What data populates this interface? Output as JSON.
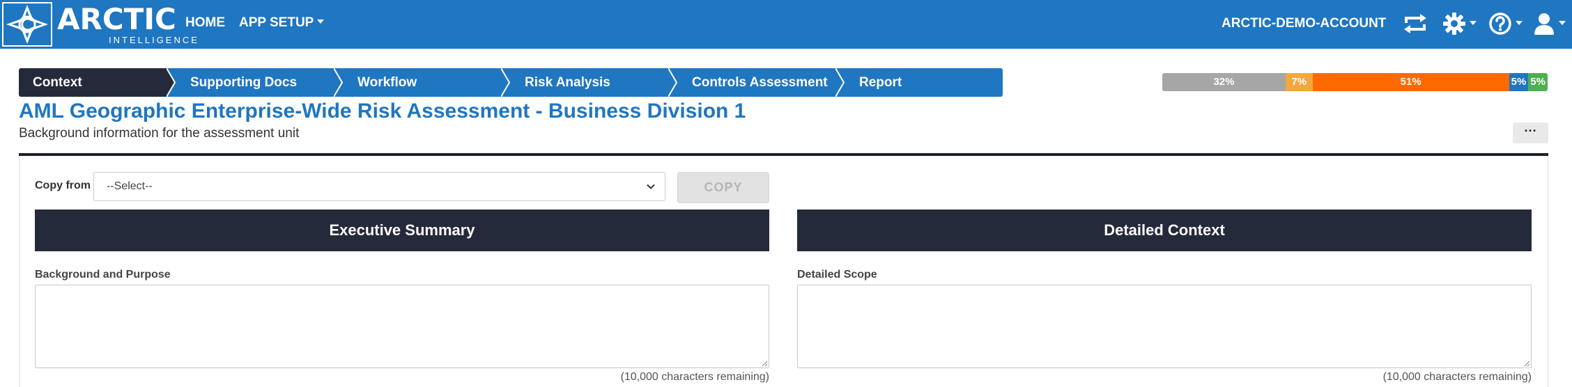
{
  "navbar": {
    "brand_name": "ARCTIC",
    "brand_sub": "INTELLIGENCE",
    "home_label": "HOME",
    "app_setup_label": "APP SETUP",
    "account_label": "ARCTIC-DEMO-ACCOUNT",
    "icons": [
      "sync-icon",
      "gear-icon",
      "help-icon",
      "user-icon"
    ],
    "color": "#1f76c1"
  },
  "steps": [
    {
      "label": "Context",
      "active": true
    },
    {
      "label": "Supporting Docs",
      "active": false
    },
    {
      "label": "Workflow",
      "active": false
    },
    {
      "label": "Risk Analysis",
      "active": false
    },
    {
      "label": "Controls Assessment",
      "active": false
    },
    {
      "label": "Report",
      "active": false
    }
  ],
  "progress": [
    {
      "label": "32%",
      "value": 32,
      "color": "#a6a6a6"
    },
    {
      "label": "7%",
      "value": 7,
      "color": "#f5a63d"
    },
    {
      "label": "51%",
      "value": 51,
      "color": "#ff6a00"
    },
    {
      "label": "5%",
      "value": 5,
      "color": "#1f76c1"
    },
    {
      "label": "5%",
      "value": 5,
      "color": "#4caf50"
    }
  ],
  "page": {
    "title": "AML Geographic Enterprise-Wide Risk Assessment - Business Division 1",
    "subtitle": "Background information for the assessment unit",
    "more_label": "···"
  },
  "copy": {
    "label": "Copy from",
    "select_value": "--Select--",
    "button_label": "COPY"
  },
  "sections": {
    "left": {
      "title": "Executive Summary",
      "field_label": "Background and Purpose",
      "value": "",
      "remaining": "(10,000 characters remaining)"
    },
    "right": {
      "title": "Detailed Context",
      "field_label": "Detailed Scope",
      "value": "",
      "remaining": "(10,000 characters remaining)"
    }
  }
}
